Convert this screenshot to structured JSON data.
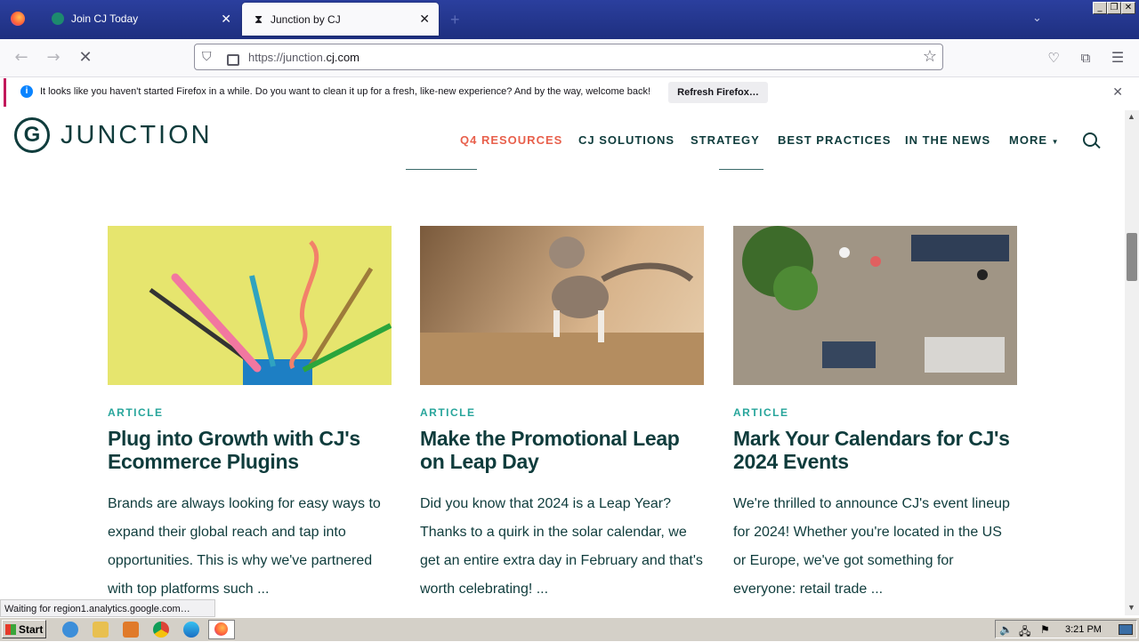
{
  "browser": {
    "tabs": [
      {
        "title": "Join CJ Today",
        "active": false
      },
      {
        "title": "Junction by CJ",
        "active": true
      }
    ],
    "url_prefix": "https://junction.",
    "url_domain": "cj.com",
    "notification": {
      "message": "It looks like you haven't started Firefox in a while. Do you want to clean it up for a fresh, like-new experience? And by the way, welcome back!",
      "button": "Refresh Firefox…"
    },
    "status": "Waiting for region1.analytics.google.com…"
  },
  "site": {
    "logo_mark": "G",
    "logo_text": "JUNCTION",
    "menu": [
      "Q4 RESOURCES",
      "CJ SOLUTIONS",
      "STRATEGY",
      "BEST PRACTICES",
      "IN THE NEWS",
      "MORE"
    ],
    "cards": [
      {
        "category": "ARTICLE",
        "title": "Plug into Growth with CJ's Ecommerce Plugins",
        "description": "Brands are always looking for easy ways to expand their global reach and tap into opportunities. This is why we've partnered with top platforms such ..."
      },
      {
        "category": "ARTICLE",
        "title": "Make the Promotional Leap on Leap Day",
        "description": "Did you know that 2024 is a Leap Year? Thanks to a quirk in the solar calendar, we get an entire extra day in February and that's worth celebrating! ..."
      },
      {
        "category": "ARTICLE",
        "title": "Mark Your Calendars for CJ's 2024 Events",
        "description": "We're thrilled to announce CJ's event lineup for 2024! Whether you're located in the US or Europe, we've got something for everyone: retail trade ..."
      }
    ]
  },
  "taskbar": {
    "start": "Start",
    "clock": "3:21 PM"
  },
  "colors": {
    "brand_dark": "#0f3c3c",
    "accent_orange": "#e8604c",
    "teal": "#27a59b"
  }
}
